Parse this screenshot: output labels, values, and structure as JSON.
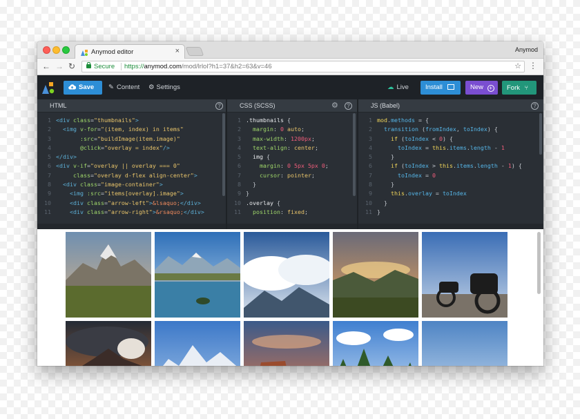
{
  "browser": {
    "tab_title": "Anymod editor",
    "tab_close": "×",
    "profile_name": "Anymod",
    "secure_label": "Secure",
    "url_scheme": "https://",
    "url_host": "anymod.com",
    "url_path": "/mod/lrlol?h1=37&h2=63&v=46",
    "star_icon": "☆",
    "menu_icon": "⋮",
    "back_icon": "←",
    "forward_icon": "→",
    "reload_icon": "↻"
  },
  "toolbar": {
    "save_label": "Save",
    "content_label": "Content",
    "settings_label": "Settings",
    "live_label": "Live",
    "install_label": "Install",
    "new_label": "New",
    "fork_label": "Fork",
    "colors": {
      "bar": "#1e2227",
      "save": "#2d8ed6",
      "install": "#2d8ed6",
      "new": "#7a4ed1",
      "fork": "#22967a",
      "live": "#2dbf9a"
    }
  },
  "panes": {
    "html": {
      "title": "HTML",
      "help_icon": "?",
      "lines": [
        {
          "n": "1",
          "tokens": [
            [
              "tag",
              "<div "
            ],
            [
              "attr",
              "class"
            ],
            [
              "pl",
              "="
            ],
            [
              "str",
              "\"thumbnails\""
            ],
            [
              "tag",
              ">"
            ]
          ]
        },
        {
          "n": "2",
          "tokens": [
            [
              "pl",
              "  "
            ],
            [
              "tag",
              "<img "
            ],
            [
              "attr",
              "v-for"
            ],
            [
              "pl",
              "="
            ],
            [
              "str",
              "\"(item, index) in items\""
            ]
          ]
        },
        {
          "n": "3",
          "tokens": [
            [
              "pl",
              "       "
            ],
            [
              "attr",
              ":src"
            ],
            [
              "pl",
              "="
            ],
            [
              "str",
              "\"buildImage(item.image)\""
            ]
          ]
        },
        {
          "n": "4",
          "tokens": [
            [
              "pl",
              "       "
            ],
            [
              "attr",
              "@click"
            ],
            [
              "pl",
              "="
            ],
            [
              "str",
              "\"overlay = index\""
            ],
            [
              "tag",
              "/>"
            ]
          ]
        },
        {
          "n": "5",
          "tokens": [
            [
              "tag",
              "</div>"
            ]
          ]
        },
        {
          "n": "6",
          "tokens": [
            [
              "tag",
              "<div "
            ],
            [
              "attr",
              "v-if"
            ],
            [
              "pl",
              "="
            ],
            [
              "str",
              "\"overlay || overlay === 0\""
            ]
          ]
        },
        {
          "n": "7",
          "tokens": [
            [
              "pl",
              "     "
            ],
            [
              "attr",
              "class"
            ],
            [
              "pl",
              "="
            ],
            [
              "str",
              "\"overlay d-flex align-center\""
            ],
            [
              "tag",
              ">"
            ]
          ]
        },
        {
          "n": "8",
          "tokens": [
            [
              "pl",
              "  "
            ],
            [
              "tag",
              "<div "
            ],
            [
              "attr",
              "class"
            ],
            [
              "pl",
              "="
            ],
            [
              "str",
              "\"image-container\""
            ],
            [
              "tag",
              ">"
            ]
          ]
        },
        {
          "n": "9",
          "tokens": [
            [
              "pl",
              "    "
            ],
            [
              "tag",
              "<img "
            ],
            [
              "attr",
              ":src"
            ],
            [
              "pl",
              "="
            ],
            [
              "str",
              "\"items[overlay].image\""
            ],
            [
              "tag",
              ">"
            ]
          ]
        },
        {
          "n": "10",
          "tokens": [
            [
              "pl",
              "    "
            ],
            [
              "tag",
              "<div "
            ],
            [
              "attr",
              "class"
            ],
            [
              "pl",
              "="
            ],
            [
              "str",
              "\"arrow-left\""
            ],
            [
              "tag",
              ">"
            ],
            [
              "ent",
              "&lsaquo;"
            ],
            [
              "tag",
              "</div>"
            ]
          ]
        },
        {
          "n": "11",
          "tokens": [
            [
              "pl",
              "    "
            ],
            [
              "tag",
              "<div "
            ],
            [
              "attr",
              "class"
            ],
            [
              "pl",
              "="
            ],
            [
              "str",
              "\"arrow-right\""
            ],
            [
              "tag",
              ">"
            ],
            [
              "ent",
              "&rsaquo;"
            ],
            [
              "tag",
              "</div>"
            ]
          ]
        }
      ]
    },
    "css": {
      "title": "CSS (SCSS)",
      "help_icon": "?",
      "gear_icon": "⚙",
      "lines": [
        {
          "n": "1",
          "tokens": [
            [
              "sel",
              ".thumbnails "
            ],
            [
              "pl",
              "{"
            ]
          ]
        },
        {
          "n": "2",
          "tokens": [
            [
              "pl",
              "  "
            ],
            [
              "prop",
              "margin"
            ],
            [
              "pl",
              ": "
            ],
            [
              "num",
              "0"
            ],
            [
              "pl",
              " "
            ],
            [
              "str",
              "auto"
            ],
            [
              "pl",
              ";"
            ]
          ]
        },
        {
          "n": "3",
          "tokens": [
            [
              "pl",
              "  "
            ],
            [
              "prop",
              "max-width"
            ],
            [
              "pl",
              ": "
            ],
            [
              "num",
              "1200px"
            ],
            [
              "pl",
              ";"
            ]
          ]
        },
        {
          "n": "4",
          "tokens": [
            [
              "pl",
              "  "
            ],
            [
              "prop",
              "text-align"
            ],
            [
              "pl",
              ": "
            ],
            [
              "str",
              "center"
            ],
            [
              "pl",
              ";"
            ]
          ]
        },
        {
          "n": "5",
          "tokens": [
            [
              "pl",
              "  "
            ],
            [
              "sel",
              "img "
            ],
            [
              "pl",
              "{"
            ]
          ]
        },
        {
          "n": "6",
          "tokens": [
            [
              "pl",
              "    "
            ],
            [
              "prop",
              "margin"
            ],
            [
              "pl",
              ": "
            ],
            [
              "num",
              "0 5px 5px 0"
            ],
            [
              "pl",
              ";"
            ]
          ]
        },
        {
          "n": "7",
          "tokens": [
            [
              "pl",
              "    "
            ],
            [
              "prop",
              "cursor"
            ],
            [
              "pl",
              ": "
            ],
            [
              "str",
              "pointer"
            ],
            [
              "pl",
              ";"
            ]
          ]
        },
        {
          "n": "8",
          "tokens": [
            [
              "pl",
              "  }"
            ]
          ]
        },
        {
          "n": "9",
          "tokens": [
            [
              "pl",
              "}"
            ]
          ]
        },
        {
          "n": "10",
          "tokens": [
            [
              "sel",
              ".overlay "
            ],
            [
              "pl",
              "{"
            ]
          ]
        },
        {
          "n": "11",
          "tokens": [
            [
              "pl",
              "  "
            ],
            [
              "prop",
              "position"
            ],
            [
              "pl",
              ": "
            ],
            [
              "str",
              "fixed"
            ],
            [
              "pl",
              ";"
            ]
          ]
        }
      ]
    },
    "js": {
      "title": "JS (Babel)",
      "help_icon": "?",
      "lines": [
        {
          "n": "1",
          "tokens": [
            [
              "fn",
              "mod"
            ],
            [
              "pl",
              "."
            ],
            [
              "kw",
              "methods"
            ],
            [
              "pl",
              " = {"
            ]
          ]
        },
        {
          "n": "2",
          "tokens": [
            [
              "pl",
              "  "
            ],
            [
              "kw",
              "transition"
            ],
            [
              "pl",
              " ("
            ],
            [
              "kw",
              "fromIndex"
            ],
            [
              "pl",
              ", "
            ],
            [
              "kw",
              "toIndex"
            ],
            [
              "pl",
              ") {"
            ]
          ]
        },
        {
          "n": "3",
          "tokens": [
            [
              "pl",
              "    "
            ],
            [
              "fn",
              "if"
            ],
            [
              "pl",
              " ("
            ],
            [
              "kw",
              "toIndex"
            ],
            [
              "pl",
              " < "
            ],
            [
              "num",
              "0"
            ],
            [
              "pl",
              ") {"
            ]
          ]
        },
        {
          "n": "4",
          "tokens": [
            [
              "pl",
              "      "
            ],
            [
              "kw",
              "toIndex"
            ],
            [
              "pl",
              " = "
            ],
            [
              "fn",
              "this"
            ],
            [
              "pl",
              "."
            ],
            [
              "kw",
              "items"
            ],
            [
              "pl",
              "."
            ],
            [
              "kw",
              "length"
            ],
            [
              "pl",
              " - "
            ],
            [
              "num",
              "1"
            ]
          ]
        },
        {
          "n": "5",
          "tokens": [
            [
              "pl",
              "    }"
            ]
          ]
        },
        {
          "n": "6",
          "tokens": [
            [
              "pl",
              "    "
            ],
            [
              "fn",
              "if"
            ],
            [
              "pl",
              " ("
            ],
            [
              "kw",
              "toIndex"
            ],
            [
              "pl",
              " > "
            ],
            [
              "fn",
              "this"
            ],
            [
              "pl",
              "."
            ],
            [
              "kw",
              "items"
            ],
            [
              "pl",
              "."
            ],
            [
              "kw",
              "length"
            ],
            [
              "pl",
              " - "
            ],
            [
              "num",
              "1"
            ],
            [
              "pl",
              ") {"
            ]
          ]
        },
        {
          "n": "7",
          "tokens": [
            [
              "pl",
              "      "
            ],
            [
              "kw",
              "toIndex"
            ],
            [
              "pl",
              " = "
            ],
            [
              "num",
              "0"
            ]
          ]
        },
        {
          "n": "8",
          "tokens": [
            [
              "pl",
              "    }"
            ]
          ]
        },
        {
          "n": "9",
          "tokens": [
            [
              "pl",
              "    "
            ],
            [
              "fn",
              "this"
            ],
            [
              "pl",
              "."
            ],
            [
              "kw",
              "overlay"
            ],
            [
              "pl",
              " = "
            ],
            [
              "kw",
              "toIndex"
            ]
          ]
        },
        {
          "n": "10",
          "tokens": [
            [
              "pl",
              "  }"
            ]
          ]
        },
        {
          "n": "11",
          "tokens": [
            [
              "pl",
              "}"
            ]
          ]
        }
      ]
    }
  },
  "gallery": {
    "thumbnails": [
      {
        "subject": "mountain-peak-meadow",
        "sky_top": "#6f8fb0",
        "sky_bottom": "#d9b58a",
        "ground": "#5b6b2e",
        "accent": "#e8e8e8"
      },
      {
        "subject": "alpine-lake",
        "sky_top": "#2e6fb8",
        "sky_bottom": "#bcd8ef",
        "ground": "#3a7fa6",
        "accent": "#f2f2f2"
      },
      {
        "subject": "clouds-over-peaks",
        "sky_top": "#2a5a9a",
        "sky_bottom": "#dfe7f0",
        "ground": "#41566d",
        "accent": "#ffffff"
      },
      {
        "subject": "sunset-valley",
        "sky_top": "#6a6a78",
        "sky_bottom": "#e9a45a",
        "ground": "#3c4a22",
        "accent": "#f4d18a"
      },
      {
        "subject": "motorcycles",
        "sky_top": "#3a6db5",
        "sky_bottom": "#c7d6e8",
        "ground": "#7a7268",
        "accent": "#1c1c1c"
      },
      {
        "subject": "volcano-clouds",
        "sky_top": "#242b36",
        "sky_bottom": "#c9743a",
        "ground": "#3b2c28",
        "accent": "#e6e0d8"
      },
      {
        "subject": "snowy-range",
        "sky_top": "#3c78c8",
        "sky_bottom": "#a9c8ea",
        "ground": "#e9eef5",
        "accent": "#ffffff"
      },
      {
        "subject": "desert-mesa",
        "sky_top": "#3b5a8a",
        "sky_bottom": "#e07a4a",
        "ground": "#9a4c2e",
        "accent": "#f0b080"
      },
      {
        "subject": "pine-forest",
        "sky_top": "#3f7fd0",
        "sky_bottom": "#cfe2f5",
        "ground": "#2f5a2a",
        "accent": "#ffffff"
      },
      {
        "subject": "hazy-sky",
        "sky_top": "#4e84c4",
        "sky_bottom": "#c9dcf0",
        "ground": "#dfe9f4",
        "accent": "#f5f0e8"
      }
    ]
  }
}
